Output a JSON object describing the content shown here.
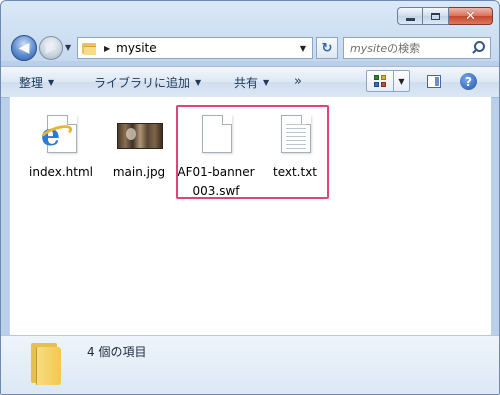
{
  "window": {
    "caption": {
      "minimize": "minimize",
      "maximize": "maximize",
      "close": "✕"
    }
  },
  "nav": {
    "back": "◀",
    "forward": "▶",
    "address": "mysite",
    "breadcrumb_separator": "▶",
    "refresh": "↻",
    "search_placeholder_name": "mysite",
    "search_placeholder_suffix": "の検索"
  },
  "toolbar": {
    "organize": "整理",
    "add_to_library": "ライブラリに追加",
    "share": "共有",
    "more": "»",
    "help": "?"
  },
  "files": [
    {
      "name": "index.html",
      "icon": "ie-html-icon"
    },
    {
      "name": "main.jpg",
      "icon": "image-thumbnail-icon"
    },
    {
      "name": "AF01-banner003.swf",
      "icon": "blank-file-icon"
    },
    {
      "name": "text.txt",
      "icon": "text-file-icon"
    }
  ],
  "details": {
    "item_count": "4 個の項目"
  },
  "colors": {
    "highlight": "#e3417a",
    "accent": "#2f66b3"
  }
}
